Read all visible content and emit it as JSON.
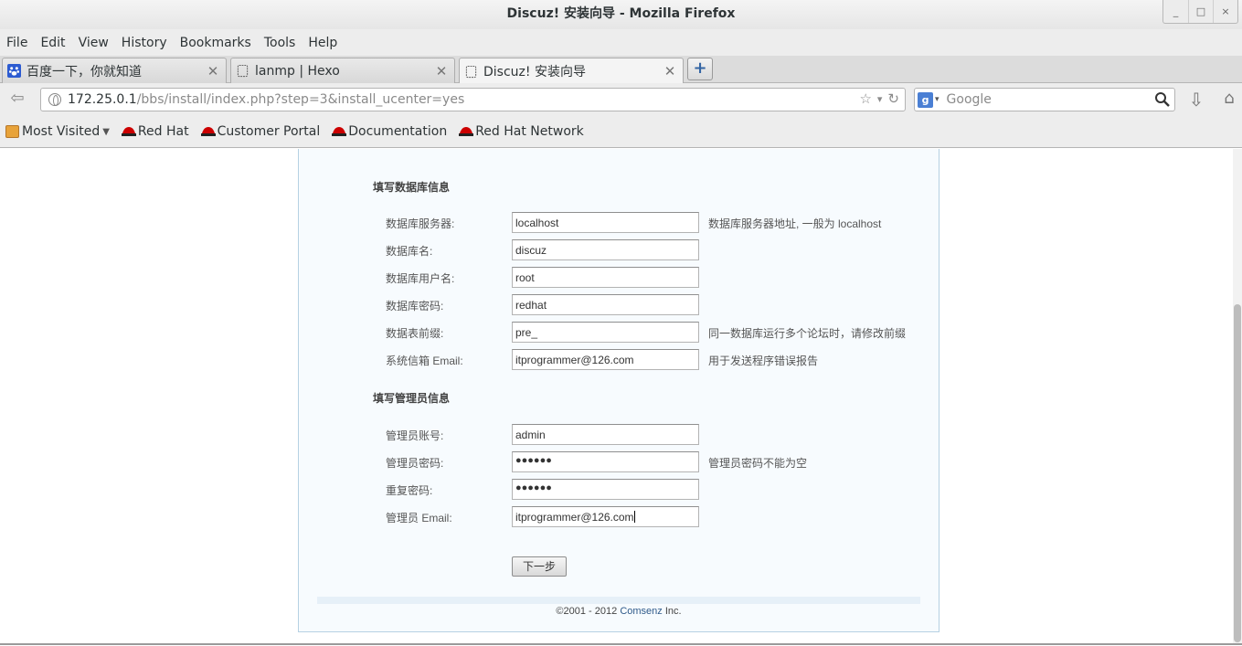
{
  "window": {
    "title": "Discuz! 安装向导 - Mozilla Firefox",
    "controls": [
      "_",
      "□",
      "×"
    ]
  },
  "menu": [
    "File",
    "Edit",
    "View",
    "History",
    "Bookmarks",
    "Tools",
    "Help"
  ],
  "tabs": [
    {
      "label": "百度一下，你就知道",
      "icon": "baidu-paw-icon",
      "active": false
    },
    {
      "label": "lanmp | Hexo",
      "icon": "blank-page-icon",
      "active": false
    },
    {
      "label": "Discuz! 安装向导",
      "icon": "blank-page-icon",
      "active": true
    }
  ],
  "newtab_symbol": "+",
  "nav": {
    "url_host": "172.25.0.1",
    "url_path": "/bbs/install/index.php?step=3&install_ucenter=yes",
    "search_placeholder": "Google",
    "search_engine_letter": "g"
  },
  "bookmarks": [
    "Most Visited",
    "Red Hat",
    "Customer Portal",
    "Documentation",
    "Red Hat Network"
  ],
  "form": {
    "db_section_title": "填写数据库信息",
    "admin_section_title": "填写管理员信息",
    "db_fields": [
      {
        "label": "数据库服务器:",
        "value": "localhost",
        "hint": "数据库服务器地址, 一般为 localhost"
      },
      {
        "label": "数据库名:",
        "value": "discuz",
        "hint": ""
      },
      {
        "label": "数据库用户名:",
        "value": "root",
        "hint": ""
      },
      {
        "label": "数据库密码:",
        "value": "redhat",
        "hint": ""
      },
      {
        "label": "数据表前缀:",
        "value": "pre_",
        "hint": "同一数据库运行多个论坛时，请修改前缀"
      },
      {
        "label": "系统信箱 Email:",
        "value": "itprogrammer@126.com",
        "hint": "用于发送程序错误报告"
      }
    ],
    "admin_fields": [
      {
        "label": "管理员账号:",
        "value": "admin",
        "hint": ""
      },
      {
        "label": "管理员密码:",
        "value": "●●●●●●",
        "hint": "管理员密码不能为空"
      },
      {
        "label": "重复密码:",
        "value": "●●●●●●",
        "hint": ""
      },
      {
        "label": "管理员 Email:",
        "value": "itprogrammer@126.com",
        "hint": ""
      }
    ],
    "next_button": "下一步"
  },
  "footer": {
    "copyright": "©2001 - 2012 ",
    "brand": "Comsenz",
    "suffix": " Inc."
  }
}
